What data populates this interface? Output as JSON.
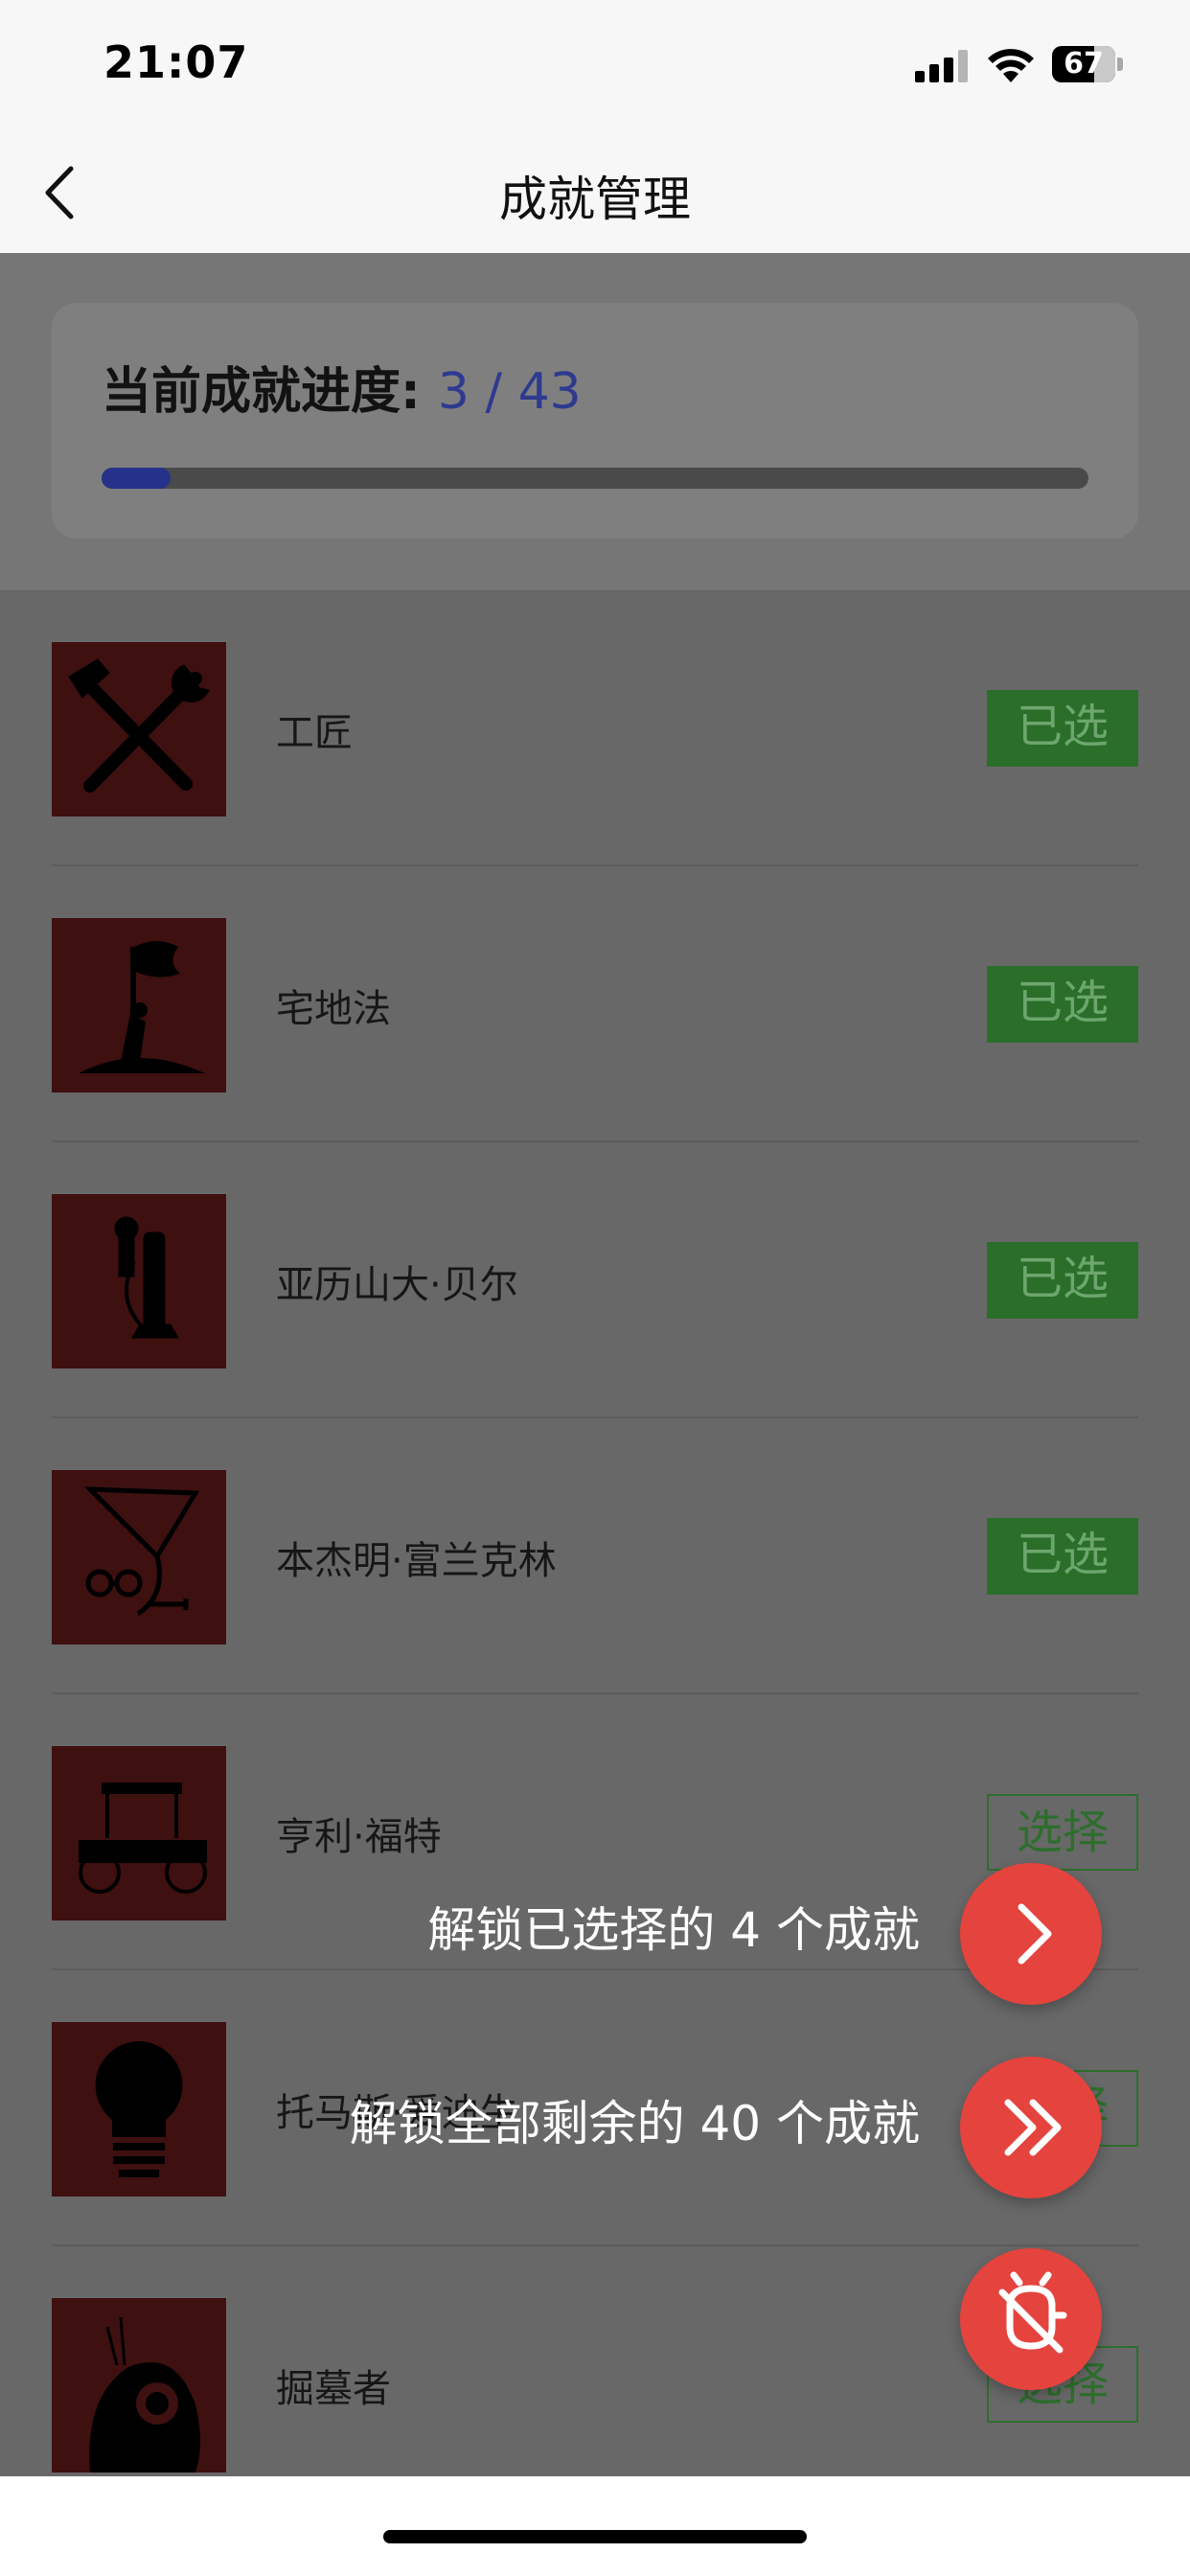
{
  "status_bar": {
    "time": "21:07",
    "battery": "67",
    "battery_level": 0.67,
    "icons": [
      "cellular-signal-icon",
      "wifi-icon",
      "battery-icon"
    ]
  },
  "nav": {
    "title": "成就管理",
    "back_icon": "chevron-left-icon"
  },
  "progress": {
    "label": "当前成就进度: ",
    "value": "3 / 43",
    "fraction": 0.0698,
    "accent": "#2d3a8f"
  },
  "achievements": [
    {
      "name": "工匠",
      "status": "已选",
      "icon": "hammer-wrench-icon"
    },
    {
      "name": "宅地法",
      "status": "已选",
      "icon": "flag-raising-icon"
    },
    {
      "name": "亚历山大·贝尔",
      "status": "已选",
      "icon": "candlestick-telephone-icon"
    },
    {
      "name": "本杰明·富兰克林",
      "status": "已选",
      "icon": "kite-key-spectacles-icon"
    },
    {
      "name": "亨利·福特",
      "status": "选择",
      "icon": "model-t-car-icon"
    },
    {
      "name": "托马斯·爱迪生",
      "status": "选择",
      "icon": "light-bulb-icon"
    },
    {
      "name": "掘墓者",
      "status": "选择",
      "icon": "skull-head-icon"
    }
  ],
  "fab": {
    "unlock_selected": "解锁已选择的 4 个成就",
    "unlock_all": "解锁全部剩余的 40 个成就",
    "colors": {
      "fab": "#e5433d",
      "selected_tag": "#2a6e2a",
      "select_tag": "#2d6e2d"
    },
    "icons": [
      "chevron-right-icon",
      "double-chevron-right-icon",
      "bug-off-icon"
    ]
  }
}
